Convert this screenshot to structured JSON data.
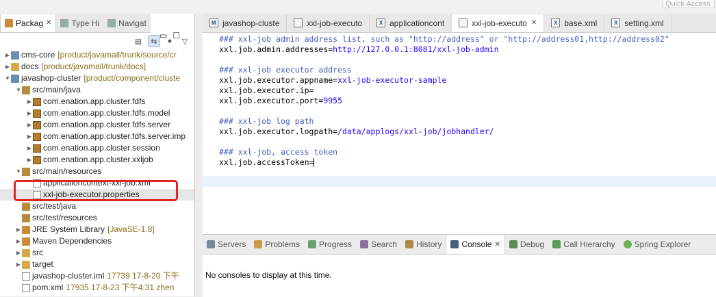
{
  "quick_access": {
    "placeholder": "Quick Access"
  },
  "left_tabs": [
    {
      "label": "Packag",
      "active": true
    },
    {
      "label": "Type Hi",
      "active": false
    },
    {
      "label": "Navigat",
      "active": false
    }
  ],
  "tree": [
    {
      "indent": 0,
      "twisty": "▶",
      "icon": "proj",
      "label": "cms-core",
      "decor": "[product/javamall/trunk/source/cr"
    },
    {
      "indent": 0,
      "twisty": "▶",
      "icon": "folder",
      "label": "docs",
      "decor": "[product/javamall/trunk/docs]"
    },
    {
      "indent": 0,
      "twisty": "▼",
      "icon": "proj",
      "label": "javashop-cluster",
      "decor": "[product/component/cluste"
    },
    {
      "indent": 1,
      "twisty": "▼",
      "icon": "src",
      "label": "src/main/java",
      "decor": ""
    },
    {
      "indent": 2,
      "twisty": "▶",
      "icon": "pkg",
      "label": "com.enation.app.cluster.fdfs",
      "decor": ""
    },
    {
      "indent": 2,
      "twisty": "▶",
      "icon": "pkg",
      "label": "com.enation.app.cluster.fdfs.model",
      "decor": ""
    },
    {
      "indent": 2,
      "twisty": "▶",
      "icon": "pkg",
      "label": "com.enation.app.cluster.fdfs.server",
      "decor": ""
    },
    {
      "indent": 2,
      "twisty": "▶",
      "icon": "pkg",
      "label": "com.enation.app.cluster.fdfs.server.imp",
      "decor": ""
    },
    {
      "indent": 2,
      "twisty": "▶",
      "icon": "pkg",
      "label": "com.enation.app.cluster.session",
      "decor": ""
    },
    {
      "indent": 2,
      "twisty": "▶",
      "icon": "pkg",
      "label": "com.enation.app.cluster.xxljob",
      "decor": ""
    },
    {
      "indent": 1,
      "twisty": "▼",
      "icon": "src",
      "label": "src/main/resources",
      "decor": ""
    },
    {
      "indent": 2,
      "twisty": "",
      "icon": "file",
      "label": "applicationcontext-xxl-job.xml",
      "decor": ""
    },
    {
      "indent": 2,
      "twisty": "",
      "icon": "file",
      "label": "xxl-job-executor.properties",
      "decor": "",
      "selected": true
    },
    {
      "indent": 1,
      "twisty": "",
      "icon": "src",
      "label": "src/test/java",
      "decor": ""
    },
    {
      "indent": 1,
      "twisty": "",
      "icon": "src",
      "label": "src/test/resources",
      "decor": ""
    },
    {
      "indent": 1,
      "twisty": "▶",
      "icon": "jar",
      "label": "JRE System Library",
      "decor": "[JavaSE-1.8]"
    },
    {
      "indent": 1,
      "twisty": "▶",
      "icon": "jar",
      "label": "Maven Dependencies",
      "decor": ""
    },
    {
      "indent": 1,
      "twisty": "▶",
      "icon": "folder",
      "label": "src",
      "decor": ""
    },
    {
      "indent": 1,
      "twisty": "▶",
      "icon": "folder",
      "label": "target",
      "decor": ""
    },
    {
      "indent": 1,
      "twisty": "",
      "icon": "file",
      "label": "javashop-cluster.iml",
      "decor": "17739  17-8-20 下午"
    },
    {
      "indent": 1,
      "twisty": "",
      "icon": "file",
      "label": "pom.xml",
      "decor": "17935  17-8-23 下午4:31  zhen"
    }
  ],
  "editor_tabs": [
    {
      "label": "javashop-cluste",
      "icon": "M",
      "active": false,
      "closable": false
    },
    {
      "label": "xxl-job-executo",
      "icon": "",
      "active": false,
      "closable": false
    },
    {
      "label": "applicationcont",
      "icon": "X",
      "active": false,
      "closable": false
    },
    {
      "label": "xxl-job-executo",
      "icon": "",
      "active": true,
      "closable": true
    },
    {
      "label": "base.xml",
      "icon": "X",
      "active": false,
      "closable": false
    },
    {
      "label": "setting.xml",
      "icon": "X",
      "active": false,
      "closable": false
    }
  ],
  "code_lines": [
    {
      "type": "comment",
      "text": "### xxl-job admin address list, such as \"http://address\" or \"http://address01,http://address02\""
    },
    {
      "type": "kv",
      "key": "xxl.job.admin.addresses=",
      "value": "http://127.0.0.1:8081/xxl-job-admin"
    },
    {
      "type": "blank"
    },
    {
      "type": "comment",
      "text": "### xxl-job executor address"
    },
    {
      "type": "kv",
      "key": "xxl.job.executor.appname=",
      "value": "xxl-job-executor-sample"
    },
    {
      "type": "kv",
      "key": "xxl.job.executor.ip=",
      "value": ""
    },
    {
      "type": "kv",
      "key": "xxl.job.executor.port=",
      "value": "9955"
    },
    {
      "type": "blank"
    },
    {
      "type": "comment",
      "text": "### xxl-job log path"
    },
    {
      "type": "kv",
      "key": "xxl.job.executor.logpath=",
      "value": "/data/applogs/xxl-job/jobhandler/"
    },
    {
      "type": "blank"
    },
    {
      "type": "comment",
      "text": "### xxl-job, access token"
    },
    {
      "type": "kv",
      "key": "xxl.job.accessToken=",
      "value": "",
      "caret": true
    }
  ],
  "console_tabs": [
    {
      "label": "Servers",
      "icon": "servers-icon",
      "active": false
    },
    {
      "label": "Problems",
      "icon": "problems-icon",
      "active": false
    },
    {
      "label": "Progress",
      "icon": "progress-icon",
      "active": false
    },
    {
      "label": "Search",
      "icon": "search-icon",
      "active": false
    },
    {
      "label": "History",
      "icon": "history-icon",
      "active": false
    },
    {
      "label": "Console",
      "icon": "console-icon",
      "active": true
    },
    {
      "label": "Debug",
      "icon": "debug-icon",
      "active": false
    },
    {
      "label": "Call Hierarchy",
      "icon": "call-hierarchy-icon",
      "active": false
    },
    {
      "label": "Spring Explorer",
      "icon": "spring-icon",
      "active": false
    }
  ],
  "console_message": "No consoles to display at this time.",
  "colors": {
    "highlight": "#e0261f",
    "comment": "#3f5fbf",
    "value": "#2a00ff"
  }
}
